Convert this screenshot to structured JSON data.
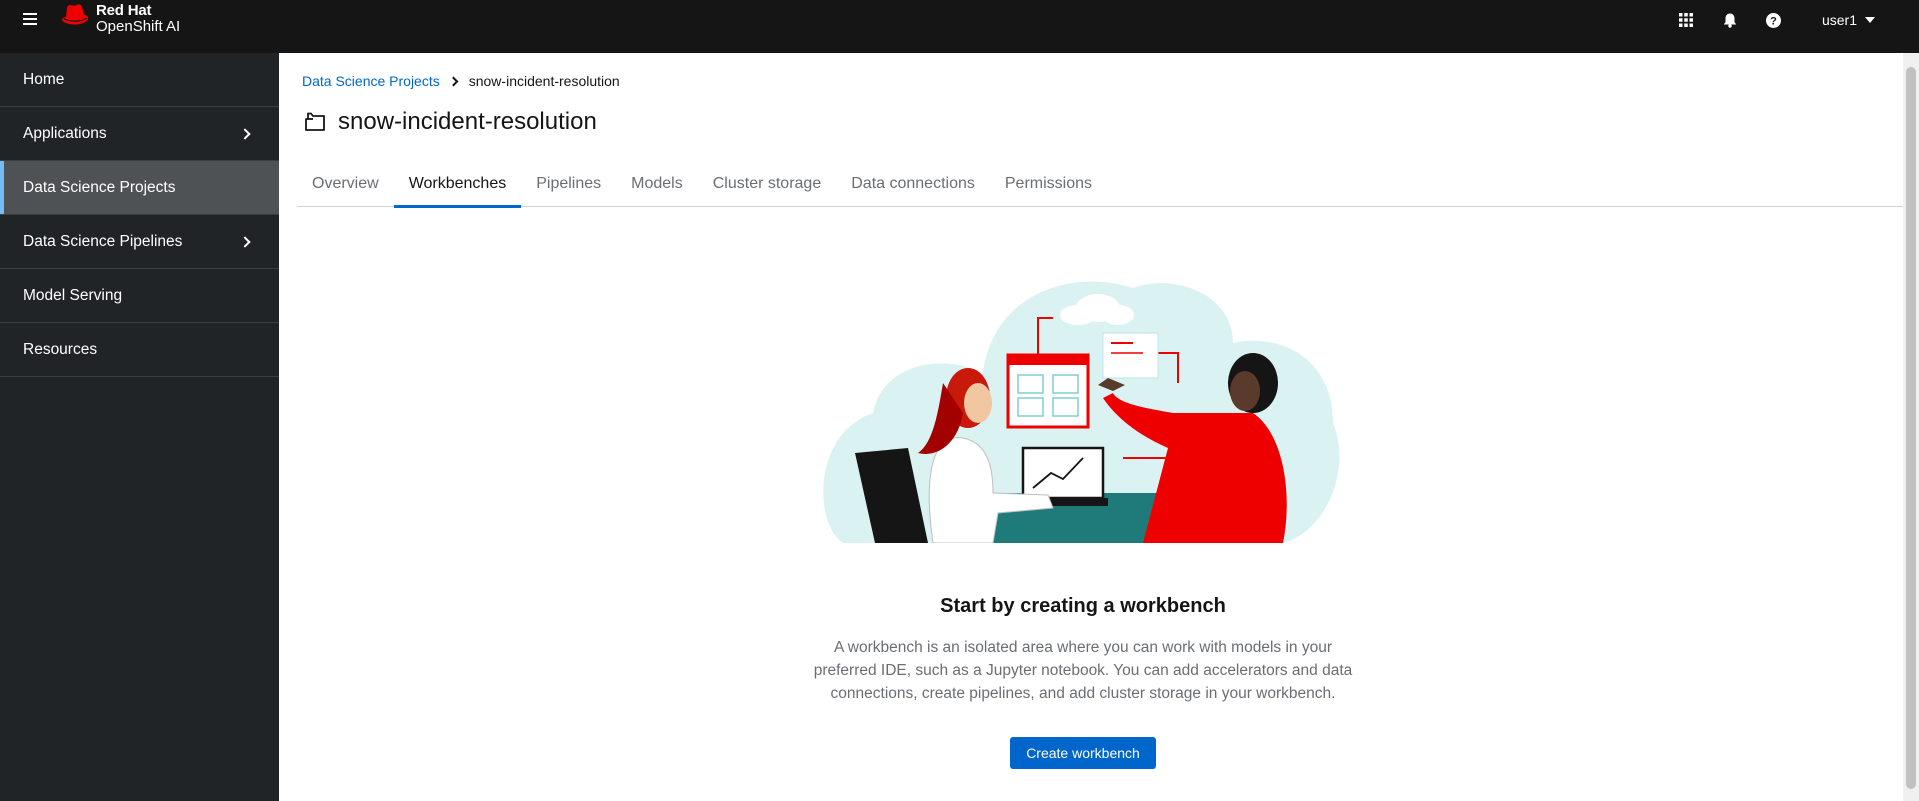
{
  "brand": {
    "line1": "Red Hat",
    "line2": "OpenShift AI"
  },
  "header": {
    "apps_icon": "grid-icon",
    "notifications_icon": "bell-icon",
    "help_icon": "help-icon",
    "user": "user1"
  },
  "sidebar": {
    "items": [
      {
        "label": "Home",
        "has_children": false,
        "active": false
      },
      {
        "label": "Applications",
        "has_children": true,
        "active": false
      },
      {
        "label": "Data Science Projects",
        "has_children": false,
        "active": true
      },
      {
        "label": "Data Science Pipelines",
        "has_children": true,
        "active": false
      },
      {
        "label": "Model Serving",
        "has_children": false,
        "active": false
      },
      {
        "label": "Resources",
        "has_children": false,
        "active": false
      }
    ]
  },
  "breadcrumb": {
    "parent": "Data Science Projects",
    "current": "snow-incident-resolution"
  },
  "page": {
    "title": "snow-incident-resolution",
    "icon": "project-icon"
  },
  "tabs": [
    {
      "label": "Overview",
      "active": false
    },
    {
      "label": "Workbenches",
      "active": true
    },
    {
      "label": "Pipelines",
      "active": false
    },
    {
      "label": "Models",
      "active": false
    },
    {
      "label": "Cluster storage",
      "active": false
    },
    {
      "label": "Data connections",
      "active": false
    },
    {
      "label": "Permissions",
      "active": false
    }
  ],
  "empty_state": {
    "title": "Start by creating a workbench",
    "body": "A workbench is an isolated area where you can work with models in your preferred IDE, such as a Jupyter notebook. You can add accelerators and data connections, create pipelines, and add cluster storage in your workbench.",
    "button": "Create workbench"
  },
  "colors": {
    "accent": "#0066cc",
    "masthead": "#151515",
    "sidebar": "#212427",
    "sidebar_active": "#4f5255",
    "brand_red": "#ee0000"
  }
}
